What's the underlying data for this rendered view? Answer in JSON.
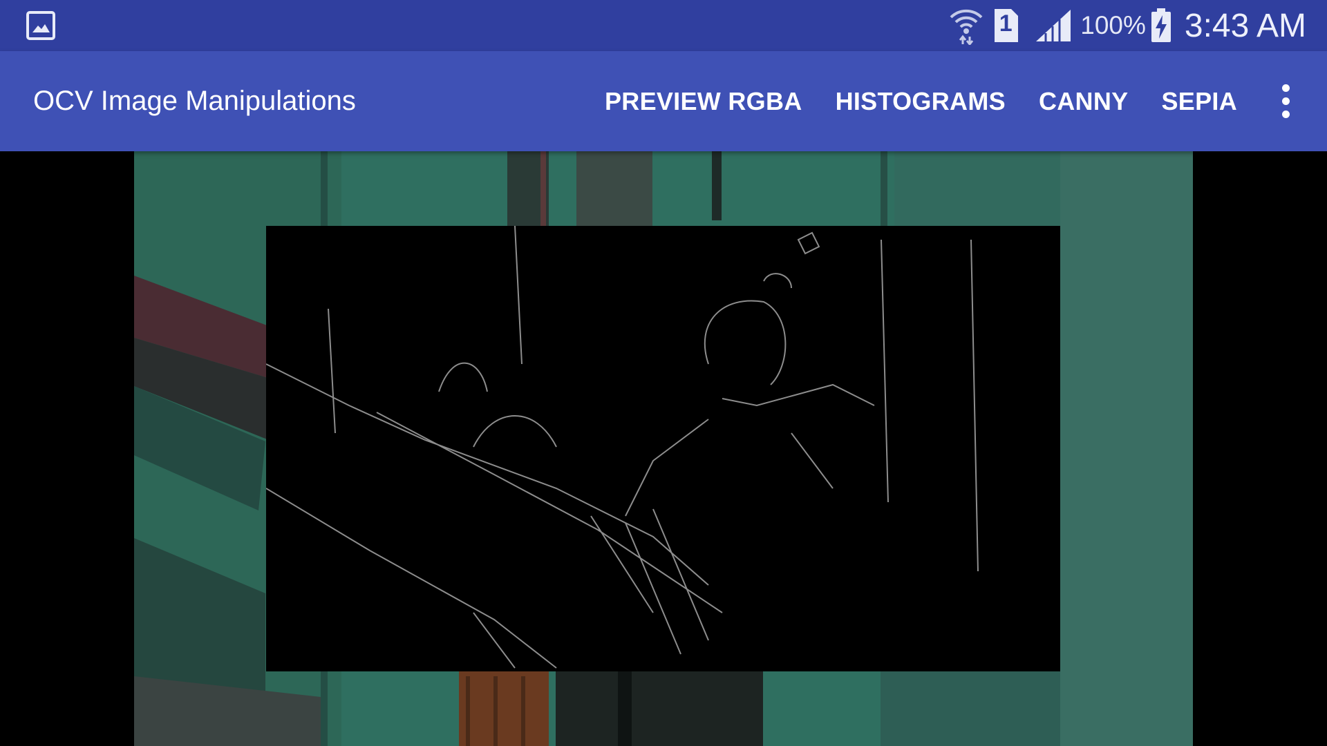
{
  "status_bar": {
    "icons": [
      "gallery-notification-icon",
      "wifi-icon",
      "sim-1-icon",
      "signal-icon",
      "battery-charging-icon"
    ],
    "sim_number": "1",
    "battery_percent": "100%",
    "time": "3:43 AM"
  },
  "app_bar": {
    "title": "OCV Image Manipulations",
    "actions": [
      "PREVIEW RGBA",
      "HISTOGRAMS",
      "CANNY",
      "SEPIA"
    ],
    "overflow_icon": "more-vert-icon"
  },
  "colors": {
    "status_bar": "#303f9f",
    "app_bar": "#3f51b5",
    "canvas_background": "#000000"
  }
}
